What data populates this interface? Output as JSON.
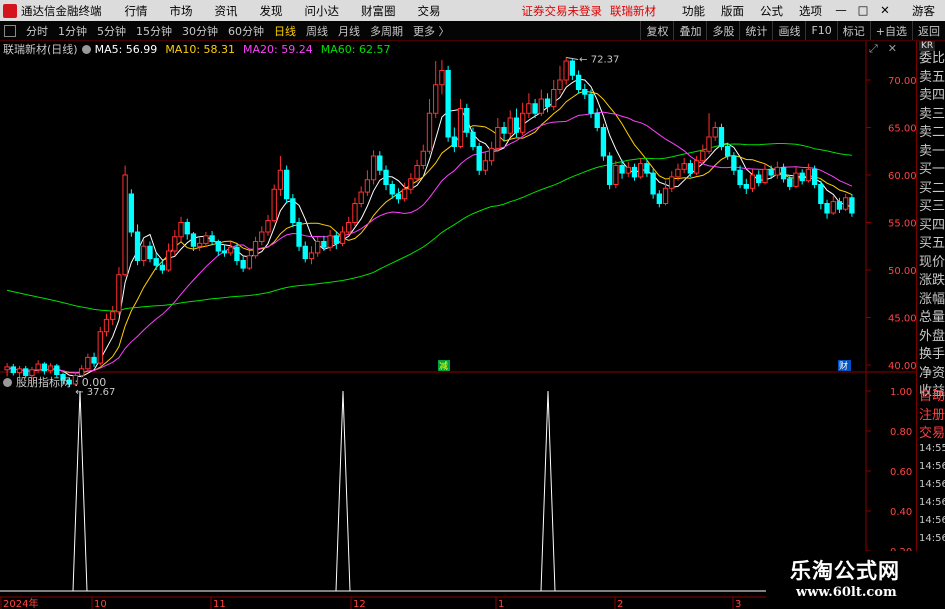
{
  "menubar": {
    "app_title": "通达信金融终端",
    "items": [
      "行情",
      "市场",
      "资讯",
      "发现",
      "问小达",
      "财富圈",
      "交易"
    ],
    "warning": "证券交易未登录",
    "stock_name": "联瑞新材",
    "right_items": [
      "功能",
      "版面",
      "公式",
      "选项"
    ],
    "min": "—",
    "max": "□",
    "close": "✕",
    "guest": "游客"
  },
  "toolbar": {
    "periods": [
      "分时",
      "1分钟",
      "5分钟",
      "15分钟",
      "30分钟",
      "60分钟",
      "日线",
      "周线",
      "月线",
      "多周期",
      "更多 〉"
    ],
    "active_index": 6,
    "right_buttons": [
      "复权",
      "叠加",
      "多股",
      "统计",
      "画线",
      "F10",
      "标记",
      "+自选",
      "返回"
    ]
  },
  "legend": {
    "stock": "联瑞新材(日线)",
    "ma5": "MA5: 56.99",
    "ma10": "MA10: 58.31",
    "ma20": "MA20: 59.24",
    "ma60": "MA60: 62.57",
    "colors": {
      "ma5": "#ffffff",
      "ma10": "#ffd000",
      "ma20": "#ff40ff",
      "ma60": "#00e000",
      "up": "#ff3030",
      "down": "#00ffff"
    }
  },
  "main_axis": {
    "labels": [
      "70.00",
      "65.00",
      "60.00",
      "55.00",
      "50.00",
      "45.00",
      "40.00"
    ],
    "values": [
      70,
      65,
      60,
      55,
      50,
      45,
      40
    ]
  },
  "annotations": {
    "high": "72.37",
    "low": "37.67",
    "mark1": "减",
    "mark2": "财"
  },
  "indicator": {
    "title": "股朋指标网 : 0.00",
    "axis_labels": [
      "1.00",
      "0.80",
      "0.60",
      "0.40",
      "0.20"
    ],
    "axis_values": [
      1.0,
      0.8,
      0.6,
      0.4,
      0.2
    ]
  },
  "xaxis": {
    "labels": [
      "2024年",
      "10",
      "11",
      "12",
      "1",
      "2",
      "3"
    ],
    "positions": [
      1,
      92,
      211,
      351,
      496,
      615,
      733
    ]
  },
  "sidepanel": {
    "badge": "KR",
    "items": [
      "委比",
      "卖五",
      "卖四",
      "卖三",
      "卖二",
      "卖一",
      "买一",
      "买二",
      "买三",
      "买四",
      "买五",
      "现价",
      "涨跌",
      "涨幅",
      "总量",
      "外盘",
      "换手",
      "净资",
      "收益",
      "自动",
      "注册",
      "交易"
    ],
    "times": [
      "14:55",
      "14:56",
      "14:56",
      "14:56",
      "14:56",
      "14:56",
      "14:56",
      "14:56"
    ]
  },
  "watermark": {
    "title": "乐淘公式网",
    "url": "www.60lt.com"
  },
  "chart_data": {
    "type": "candlestick",
    "series": [
      {
        "name": "MA5: 56.99",
        "values": []
      },
      {
        "name": "MA10: 58.31",
        "values": []
      },
      {
        "name": "MA20: 59.24",
        "values": []
      },
      {
        "name": "MA60: 62.57",
        "values": []
      }
    ],
    "candles": [
      [
        39.5,
        39.8,
        38.8,
        40.2
      ],
      [
        39.8,
        39.2,
        38.9,
        40.1
      ],
      [
        39.2,
        39.6,
        38.7,
        39.9
      ],
      [
        39.6,
        38.9,
        38.6,
        39.9
      ],
      [
        38.9,
        39.5,
        38.5,
        39.8
      ],
      [
        39.5,
        40.1,
        39.2,
        40.5
      ],
      [
        40.1,
        39.4,
        39.0,
        40.3
      ],
      [
        39.4,
        39.9,
        39.1,
        40.2
      ],
      [
        39.9,
        39.0,
        38.7,
        40.1
      ],
      [
        39.0,
        38.4,
        38.0,
        39.2
      ],
      [
        38.4,
        38.0,
        37.67,
        38.7
      ],
      [
        38.0,
        38.9,
        37.8,
        39.3
      ],
      [
        38.9,
        39.6,
        38.7,
        40.0
      ],
      [
        39.6,
        40.8,
        39.3,
        41.2
      ],
      [
        40.8,
        40.2,
        39.8,
        41.3
      ],
      [
        40.2,
        43.5,
        40.0,
        44.0
      ],
      [
        43.5,
        44.8,
        43.0,
        45.4
      ],
      [
        44.8,
        45.6,
        44.2,
        46.2
      ],
      [
        45.6,
        49.5,
        45.3,
        50.3
      ],
      [
        49.5,
        60.0,
        49.3,
        61.0
      ],
      [
        58.0,
        54.0,
        53.5,
        58.5
      ],
      [
        54.0,
        51.0,
        50.5,
        54.8
      ],
      [
        51.0,
        52.5,
        50.4,
        53.2
      ],
      [
        52.5,
        51.2,
        50.8,
        53.0
      ],
      [
        51.2,
        50.5,
        50.0,
        51.8
      ],
      [
        50.5,
        50.0,
        49.6,
        51.0
      ],
      [
        50.0,
        52.0,
        49.8,
        52.8
      ],
      [
        52.0,
        53.5,
        51.5,
        54.2
      ],
      [
        53.5,
        55.0,
        53.0,
        55.6
      ],
      [
        55.0,
        53.8,
        53.2,
        55.4
      ],
      [
        53.8,
        52.5,
        52.0,
        54.0
      ],
      [
        52.5,
        52.8,
        52.0,
        53.5
      ],
      [
        52.8,
        53.6,
        52.4,
        54.0
      ],
      [
        53.6,
        53.0,
        52.6,
        54.1
      ],
      [
        53.0,
        52.0,
        51.5,
        53.2
      ],
      [
        52.0,
        51.8,
        51.4,
        52.6
      ],
      [
        51.8,
        52.4,
        51.5,
        53.0
      ],
      [
        52.4,
        51.0,
        50.5,
        52.8
      ],
      [
        51.0,
        50.2,
        49.8,
        51.4
      ],
      [
        50.2,
        51.5,
        50.0,
        52.0
      ],
      [
        51.5,
        53.0,
        51.2,
        53.5
      ],
      [
        53.0,
        54.0,
        52.6,
        54.6
      ],
      [
        54.0,
        55.2,
        53.6,
        55.8
      ],
      [
        55.2,
        58.5,
        55.0,
        59.0
      ],
      [
        58.5,
        60.5,
        57.8,
        62.0
      ],
      [
        60.5,
        57.5,
        57.0,
        61.0
      ],
      [
        57.5,
        55.0,
        54.5,
        58.0
      ],
      [
        55.0,
        52.5,
        52.0,
        55.5
      ],
      [
        52.5,
        51.2,
        50.8,
        53.0
      ],
      [
        51.2,
        51.8,
        50.6,
        52.5
      ],
      [
        51.8,
        53.0,
        51.4,
        53.5
      ],
      [
        53.0,
        52.4,
        52.0,
        53.6
      ],
      [
        52.4,
        53.6,
        52.0,
        54.2
      ],
      [
        53.6,
        52.8,
        52.2,
        54.0
      ],
      [
        52.8,
        54.0,
        52.5,
        54.6
      ],
      [
        54.0,
        55.0,
        53.6,
        55.6
      ],
      [
        55.0,
        57.0,
        54.6,
        57.6
      ],
      [
        57.0,
        58.2,
        56.6,
        58.8
      ],
      [
        58.2,
        59.5,
        57.8,
        60.5
      ],
      [
        59.5,
        62.0,
        59.0,
        62.6
      ],
      [
        62.0,
        60.5,
        60.0,
        62.5
      ],
      [
        60.5,
        59.0,
        58.4,
        61.0
      ],
      [
        59.0,
        58.0,
        57.5,
        59.4
      ],
      [
        58.0,
        57.5,
        57.0,
        58.6
      ],
      [
        57.5,
        58.5,
        57.2,
        59.2
      ],
      [
        58.5,
        59.6,
        58.0,
        60.2
      ],
      [
        59.6,
        61.0,
        59.2,
        61.6
      ],
      [
        61.0,
        62.5,
        60.6,
        63.2
      ],
      [
        62.5,
        66.5,
        62.2,
        68.0
      ],
      [
        66.5,
        69.5,
        66.0,
        72.0
      ],
      [
        69.5,
        71.0,
        68.5,
        72.1
      ],
      [
        71.0,
        64.0,
        63.5,
        71.5
      ],
      [
        64.0,
        63.0,
        62.4,
        65.0
      ],
      [
        63.0,
        67.0,
        62.8,
        68.0
      ],
      [
        67.0,
        64.5,
        64.0,
        67.5
      ],
      [
        64.5,
        63.0,
        62.6,
        65.0
      ],
      [
        63.0,
        60.5,
        60.0,
        63.4
      ],
      [
        60.5,
        61.5,
        60.0,
        62.5
      ],
      [
        61.5,
        62.8,
        61.0,
        63.5
      ],
      [
        62.8,
        65.0,
        62.4,
        66.0
      ],
      [
        65.0,
        64.4,
        63.6,
        65.6
      ],
      [
        64.4,
        66.0,
        64.0,
        66.8
      ],
      [
        66.0,
        64.5,
        64.0,
        67.0
      ],
      [
        64.5,
        66.5,
        64.2,
        67.6
      ],
      [
        66.5,
        67.5,
        66.0,
        68.6
      ],
      [
        67.5,
        66.5,
        66.0,
        68.0
      ],
      [
        66.5,
        68.0,
        66.2,
        69.0
      ],
      [
        68.0,
        67.2,
        66.6,
        68.6
      ],
      [
        67.2,
        69.0,
        66.8,
        70.0
      ],
      [
        69.0,
        70.0,
        68.5,
        71.5
      ],
      [
        70.0,
        72.0,
        69.5,
        72.37
      ],
      [
        72.0,
        70.5,
        70.0,
        72.2
      ],
      [
        70.5,
        69.0,
        68.6,
        71.0
      ],
      [
        69.0,
        68.5,
        68.0,
        69.6
      ],
      [
        68.5,
        66.5,
        66.0,
        69.0
      ],
      [
        66.5,
        65.0,
        64.6,
        67.0
      ],
      [
        65.0,
        62.0,
        61.5,
        65.4
      ],
      [
        62.0,
        59.0,
        58.5,
        62.4
      ],
      [
        59.0,
        61.0,
        58.6,
        61.5
      ],
      [
        61.0,
        60.2,
        59.6,
        61.6
      ],
      [
        60.2,
        60.8,
        59.8,
        61.4
      ],
      [
        60.8,
        59.8,
        59.4,
        61.2
      ],
      [
        59.8,
        61.2,
        59.6,
        61.8
      ],
      [
        61.2,
        60.2,
        59.8,
        61.6
      ],
      [
        60.2,
        58.0,
        57.5,
        60.6
      ],
      [
        58.0,
        57.0,
        56.6,
        58.4
      ],
      [
        57.0,
        58.6,
        56.8,
        59.4
      ],
      [
        58.6,
        59.8,
        58.2,
        60.4
      ],
      [
        59.8,
        60.6,
        59.4,
        61.2
      ],
      [
        60.6,
        61.2,
        60.2,
        61.8
      ],
      [
        61.2,
        60.2,
        59.8,
        61.6
      ],
      [
        60.2,
        61.5,
        60.0,
        62.0
      ],
      [
        61.5,
        62.5,
        61.2,
        63.2
      ],
      [
        62.5,
        64.0,
        62.2,
        66.5
      ],
      [
        64.0,
        65.0,
        63.6,
        65.6
      ],
      [
        65.0,
        63.0,
        62.6,
        65.4
      ],
      [
        63.0,
        62.0,
        61.6,
        63.4
      ],
      [
        62.0,
        60.5,
        60.0,
        62.4
      ],
      [
        60.5,
        59.0,
        58.6,
        61.0
      ],
      [
        59.0,
        58.6,
        58.0,
        59.6
      ],
      [
        58.6,
        60.0,
        58.2,
        60.6
      ],
      [
        60.0,
        59.2,
        58.8,
        60.5
      ],
      [
        59.2,
        60.6,
        59.0,
        61.2
      ],
      [
        60.6,
        60.0,
        59.6,
        61.0
      ],
      [
        60.0,
        60.8,
        59.6,
        61.4
      ],
      [
        60.8,
        59.6,
        59.2,
        61.2
      ],
      [
        59.6,
        58.8,
        58.4,
        60.0
      ],
      [
        58.8,
        60.2,
        58.6,
        60.8
      ],
      [
        60.2,
        59.4,
        59.0,
        60.6
      ],
      [
        59.4,
        60.6,
        59.2,
        61.2
      ],
      [
        60.6,
        59.0,
        58.6,
        61.0
      ],
      [
        59.0,
        57.0,
        56.4,
        59.4
      ],
      [
        57.0,
        56.0,
        55.4,
        57.4
      ],
      [
        56.0,
        57.2,
        55.8,
        57.8
      ],
      [
        57.2,
        56.4,
        56.0,
        57.6
      ],
      [
        56.4,
        57.6,
        56.2,
        58.0
      ],
      [
        57.6,
        56.0,
        55.6,
        58.0
      ]
    ],
    "indicator_spikes": [
      80,
      343,
      548
    ],
    "ylim": [
      37.67,
      72.37
    ]
  }
}
